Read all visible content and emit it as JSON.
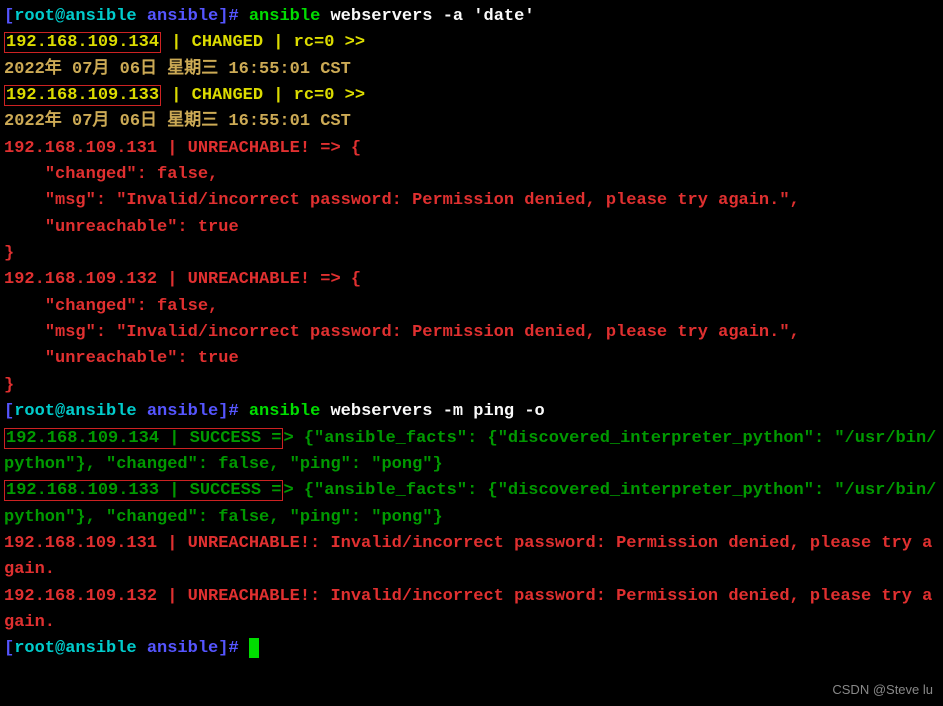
{
  "prompt1": {
    "bracket_open": "[",
    "user_host": "root@ansible",
    "path": " ansible",
    "bracket_close": "]#",
    "command_ansible": " ansible",
    "command_target": " webservers",
    "command_args": " -a 'date'"
  },
  "host134": {
    "ip": "192.168.109.134",
    "status": " | CHANGED | rc=0 >>",
    "date": "2022年 07月 06日 星期三 16:55:01 CST"
  },
  "host133": {
    "ip": "192.168.109.133",
    "status": " | CHANGED | rc=0 >>",
    "date": "2022年 07月 06日 星期三 16:55:01 CST"
  },
  "host131_err": {
    "line1": "192.168.109.131 | UNREACHABLE! => {",
    "line2": "    \"changed\": false,",
    "line3": "    \"msg\": \"Invalid/incorrect password: Permission denied, please try again.\",",
    "line4": "    \"unreachable\": true",
    "line5": "}"
  },
  "host132_err": {
    "line1": "192.168.109.132 | UNREACHABLE! => {",
    "line2": "    \"changed\": false,",
    "line3": "    \"msg\": \"Invalid/incorrect password: Permission denied, please try again.\",",
    "line4": "    \"unreachable\": true",
    "line5": "}"
  },
  "prompt2": {
    "bracket_open": "[",
    "user_host": "root@ansible",
    "path": " ansible",
    "bracket_close": "]#",
    "command_ansible": " ansible",
    "command_target": " webservers",
    "command_args": " -m ping -o"
  },
  "ping134": {
    "boxed": "192.168.109.134 | SUCCESS =",
    "after": "> {\"ansible_facts\": {\"discovered_interpreter_python\": \"/usr/bin/python\"}, \"changed\": false, \"ping\": \"pong\"}"
  },
  "ping133": {
    "boxed": "192.168.109.133 | SUCCESS =",
    "after": "> {\"ansible_facts\": {\"discovered_interpreter_python\": \"/usr/bin/python\"}, \"changed\": false, \"ping\": \"pong\"}"
  },
  "ping131_err": "192.168.109.131 | UNREACHABLE!: Invalid/incorrect password: Permission denied, please try again.",
  "ping132_err": "192.168.109.132 | UNREACHABLE!: Invalid/incorrect password: Permission denied, please try again.",
  "prompt3": {
    "bracket_open": "[",
    "user_host": "root@ansible",
    "path": " ansible",
    "bracket_close": "]#"
  },
  "watermark": "CSDN @Steve lu"
}
